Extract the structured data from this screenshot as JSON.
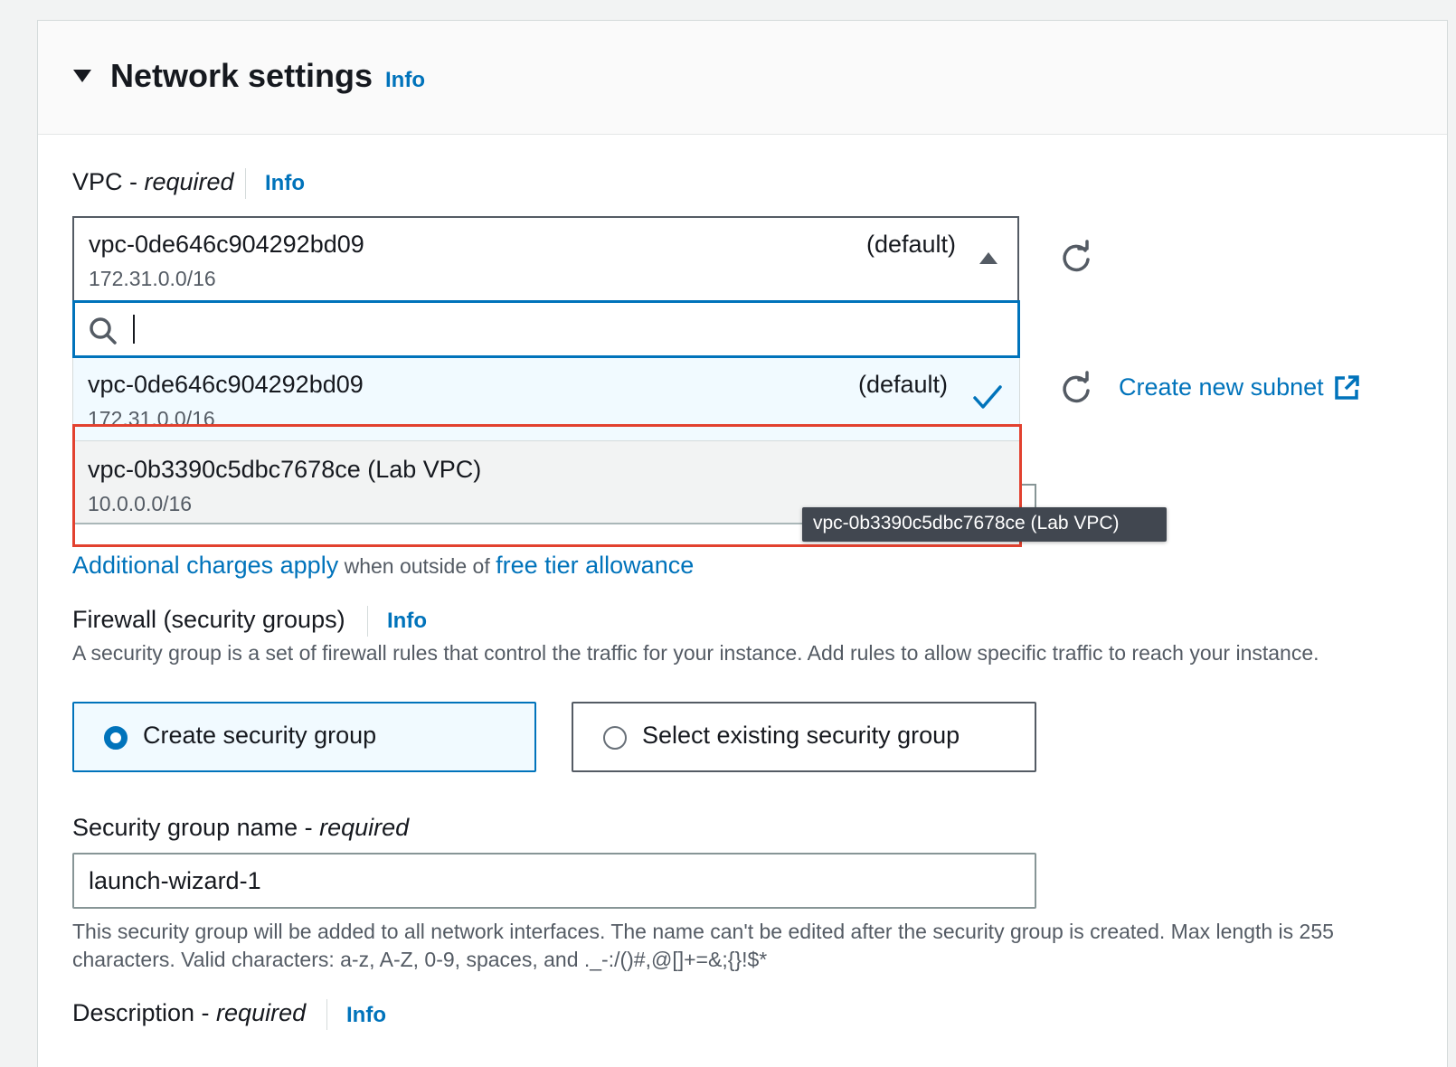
{
  "section": {
    "title": "Network settings",
    "info": "Info"
  },
  "vpc": {
    "label": "VPC - ",
    "label_required": "required",
    "info": "Info",
    "selected": {
      "id": "vpc-0de646c904292bd09",
      "tag": "(default)",
      "cidr": "172.31.0.0/16"
    },
    "search_value": "",
    "options": [
      {
        "id": "vpc-0de646c904292bd09",
        "tag": "(default)",
        "cidr": "172.31.0.0/16",
        "selected": true
      },
      {
        "id": "vpc-0b3390c5dbc7678ce (Lab VPC)",
        "tag": "",
        "cidr": "10.0.0.0/16",
        "selected": false
      }
    ],
    "tooltip": "vpc-0b3390c5dbc7678ce (Lab VPC)"
  },
  "subnet": {
    "create_link": "Create new subnet"
  },
  "charges": {
    "link1": "Additional charges apply",
    "middle": " when outside of ",
    "link2": "free tier allowance"
  },
  "firewall": {
    "label": "Firewall (security groups)",
    "info": "Info",
    "description": "A security group is a set of firewall rules that control the traffic for your instance. Add rules to allow specific traffic to reach your instance.",
    "options": [
      {
        "label": "Create security group",
        "selected": true
      },
      {
        "label": "Select existing security group",
        "selected": false
      }
    ]
  },
  "sg_name": {
    "label": "Security group name - ",
    "label_required": "required",
    "value": "launch-wizard-1",
    "help": "This security group will be added to all network interfaces. The name can't be edited after the security group is created. Max length is 255 characters. Valid characters: a-z, A-Z, 0-9, spaces, and ._-:/()#,@[]+=&;{}!$*"
  },
  "description_field": {
    "label": "Description - ",
    "label_required": "required",
    "info": "Info"
  },
  "colors": {
    "accent": "#0073bb",
    "highlight_frame": "#e2412f",
    "tooltip_bg": "#414750"
  },
  "icons": [
    "caret-down-icon",
    "caret-up-icon",
    "refresh-icon",
    "search-icon",
    "checkmark-icon",
    "external-link-icon"
  ]
}
